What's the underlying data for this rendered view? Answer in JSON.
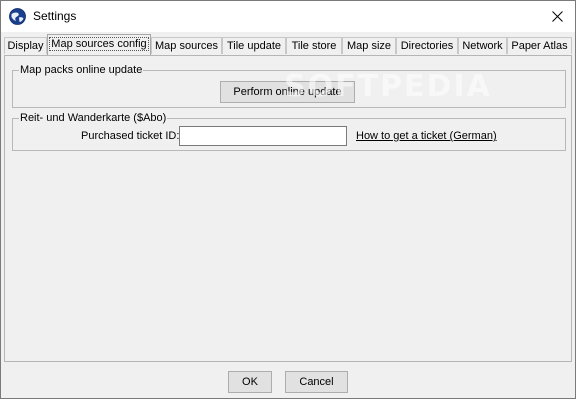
{
  "window": {
    "title": "Settings",
    "app_icon": "globe-icon",
    "close_icon": "close-icon"
  },
  "tabs": [
    {
      "label": "Display",
      "active": false
    },
    {
      "label": "Map sources config",
      "active": true
    },
    {
      "label": "Map sources",
      "active": false
    },
    {
      "label": "Tile update",
      "active": false
    },
    {
      "label": "Tile store",
      "active": false
    },
    {
      "label": "Map size",
      "active": false
    },
    {
      "label": "Directories",
      "active": false
    },
    {
      "label": "Network",
      "active": false
    },
    {
      "label": "Paper Atlas",
      "active": false
    }
  ],
  "map_packs": {
    "group_title": "Map packs online update",
    "button_label": "Perform online update"
  },
  "reit": {
    "group_title": "Reit- und Wanderkarte ($Abo)",
    "ticket_label": "Purchased ticket ID:",
    "ticket_value": "",
    "link_label": "How to get a ticket (German)"
  },
  "watermark": "SOFTPEDIA",
  "footer": {
    "ok_label": "OK",
    "cancel_label": "Cancel"
  }
}
